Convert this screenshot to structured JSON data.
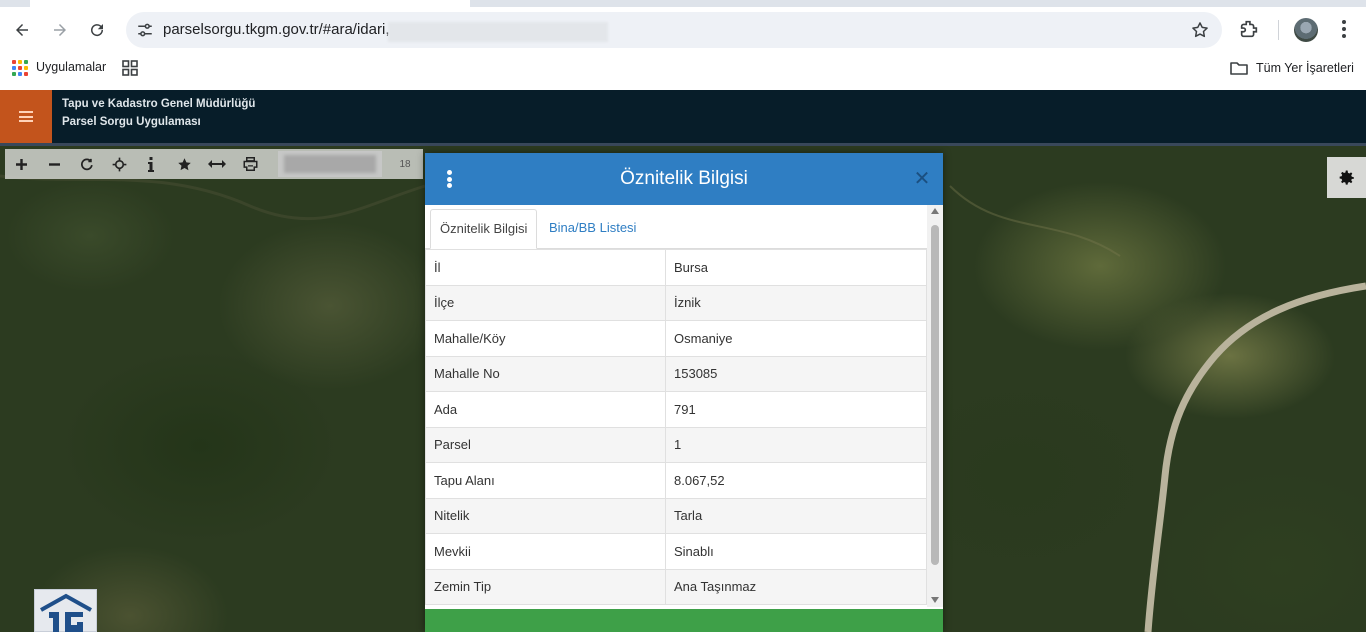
{
  "browser": {
    "url": "parselsorgu.tkgm.gov.tr/#ara/idari,",
    "bookmarks": {
      "apps_label": "Uygulamalar",
      "all_bookmarks_label": "Tüm Yer İşaretleri"
    }
  },
  "app": {
    "org_name": "Tapu ve Kadastro Genel Müdürlüğü",
    "app_name": "Parsel Sorgu Uygulaması"
  },
  "toolbar": {
    "icons": [
      "plus-icon",
      "minus-icon",
      "refresh-icon",
      "locate-icon",
      "info-icon",
      "star-icon",
      "measure-icon",
      "print-icon"
    ],
    "zoom_level": "18"
  },
  "dialog": {
    "title": "Öznitelik Bilgisi",
    "tabs": [
      "Öznitelik Bilgisi",
      "Bina/BB Listesi"
    ],
    "rows": [
      {
        "key": "İl",
        "value": "Bursa"
      },
      {
        "key": "İlçe",
        "value": "İznik"
      },
      {
        "key": "Mahalle/Köy",
        "value": "Osmaniye"
      },
      {
        "key": "Mahalle No",
        "value": "153085"
      },
      {
        "key": "Ada",
        "value": "791"
      },
      {
        "key": "Parsel",
        "value": "1"
      },
      {
        "key": "Tapu Alanı",
        "value": "8.067,52"
      },
      {
        "key": "Nitelik",
        "value": "Tarla"
      },
      {
        "key": "Mevkii",
        "value": "Sinablı"
      },
      {
        "key": "Zemin Tip",
        "value": "Ana Taşınmaz"
      }
    ]
  },
  "colors": {
    "header_bg": "#071d29",
    "menu_orange": "#c3541c",
    "dialog_blue": "#2f7ec3",
    "footer_green": "#3ea048"
  }
}
